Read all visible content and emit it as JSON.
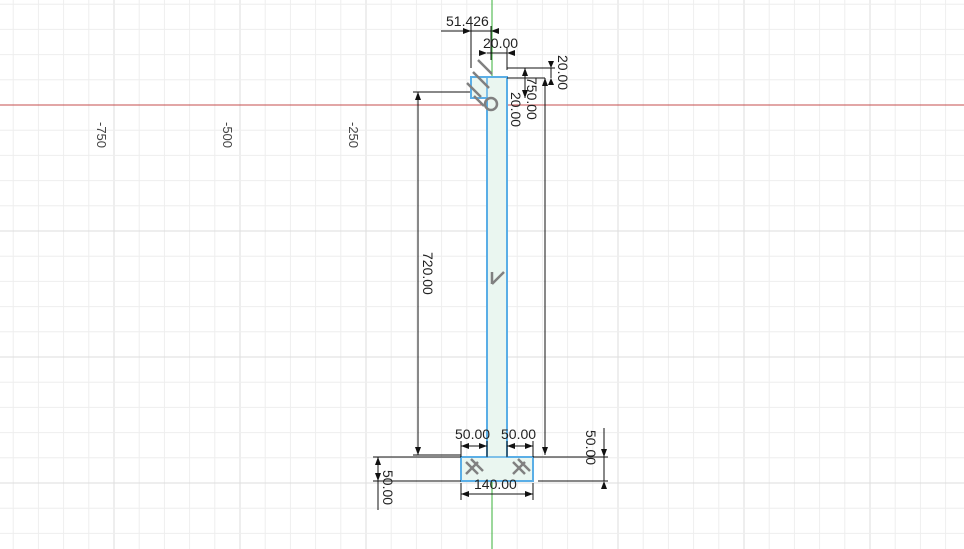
{
  "colors": {
    "background": "#ffffff",
    "grid_minor": "#eeeeee",
    "grid_major": "#dddddd",
    "x_axis": "#c44c4c",
    "y_axis": "#3ab03a",
    "profile_stroke": "#5aaee6",
    "profile_fill": "#eaf6f0",
    "dimension": "#111111",
    "constraint_glyph": "#808080"
  },
  "ruler": {
    "labels": [
      "-750",
      "-500",
      "-250"
    ]
  },
  "dimensions": {
    "top_offset": "51.426",
    "top_flange_width": "20.00",
    "top_flange_thickness": "20.00",
    "web_top_offset": "20.00",
    "total_height": "750.00",
    "web_height": "720.00",
    "base_left_overhang": "50.00",
    "base_right_overhang": "50.00",
    "base_width": "140.00",
    "base_height_right": "50.00",
    "base_height_left": "50.00"
  },
  "constraints": {
    "icons": [
      "perpendicular-icon",
      "coincident-icon",
      "parallel-icon",
      "parallel-icon",
      "perpendicular-icon"
    ]
  }
}
